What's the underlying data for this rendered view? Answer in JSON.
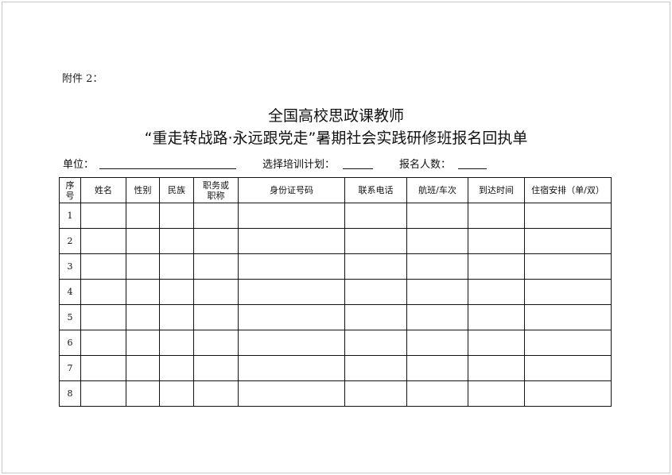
{
  "attachment_label": "附件 2：",
  "title": {
    "line1": "全国高校思政课教师",
    "line2": "“重走转战路·永远跟党走”暑期社会实践研修班报名回执单"
  },
  "fields": {
    "unit_label": "单位：",
    "plan_label": "选择培训计划：",
    "count_label": "报名人数："
  },
  "table": {
    "headers": {
      "index": "序号",
      "name": "姓名",
      "gender": "性别",
      "ethnicity": "民族",
      "title": "职务或职称",
      "id_number": "身份证号码",
      "phone": "联系电话",
      "flight_train": "航班/车次",
      "arrival_time": "到达时间",
      "lodging": "住宿安排（单/双）"
    },
    "rows": [
      "1",
      "2",
      "3",
      "4",
      "5",
      "6",
      "7",
      "8"
    ]
  }
}
